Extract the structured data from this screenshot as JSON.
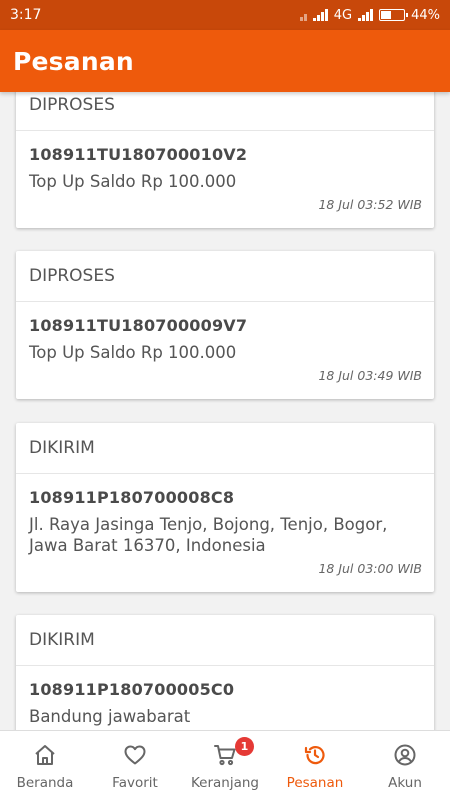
{
  "status_bar": {
    "time": "3:17",
    "network": "4G",
    "battery": "44%",
    "battery_level": 0.44
  },
  "app_bar": {
    "title": "Pesanan"
  },
  "orders": [
    {
      "status": "DIPROSES",
      "id": "108911TU180700010V2",
      "desc": "Top Up Saldo Rp 100.000",
      "time": "18 Jul 03:52 WIB"
    },
    {
      "status": "DIPROSES",
      "id": "108911TU180700009V7",
      "desc": "Top Up Saldo Rp 100.000",
      "time": "18 Jul 03:49 WIB"
    },
    {
      "status": "DIKIRIM",
      "id": "108911P180700008C8",
      "desc": "Jl. Raya Jasinga Tenjo, Bojong, Tenjo, Bogor, Jawa Barat 16370, Indonesia",
      "time": "18 Jul 03:00 WIB"
    },
    {
      "status": "DIKIRIM",
      "id": "108911P180700005C0",
      "desc": "Bandung jawabarat",
      "time": ""
    }
  ],
  "nav": {
    "items": [
      {
        "label": "Beranda",
        "icon": "home-icon"
      },
      {
        "label": "Favorit",
        "icon": "heart-icon"
      },
      {
        "label": "Keranjang",
        "icon": "cart-icon",
        "badge": "1"
      },
      {
        "label": "Pesanan",
        "icon": "history-icon",
        "active": true
      },
      {
        "label": "Akun",
        "icon": "account-icon"
      }
    ]
  },
  "colors": {
    "primary": "#ee5a0c",
    "status_bar": "#c8480a",
    "badge": "#e53935"
  }
}
